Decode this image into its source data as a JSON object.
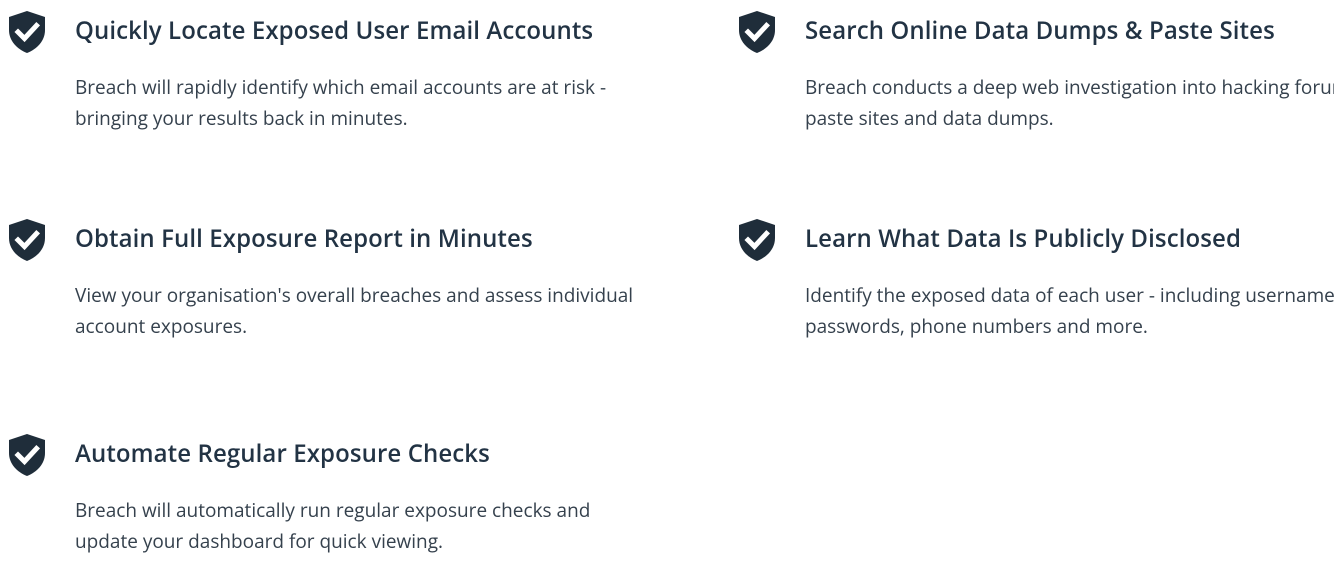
{
  "colors": {
    "icon": "#1f2d3a",
    "title": "#223344",
    "text": "#35414d",
    "background": "#ffffff"
  },
  "features": [
    {
      "icon": "shield-check-icon",
      "title": "Quickly Locate Exposed User Email Accounts",
      "description": "Breach will rapidly identify which email accounts are at risk - bringing your results back in minutes."
    },
    {
      "icon": "shield-check-icon",
      "title": "Search Online Data Dumps & Paste Sites",
      "description": "Breach conducts a deep web investigation into hacking forums, paste sites and data dumps."
    },
    {
      "icon": "shield-check-icon",
      "title": "Obtain Full Exposure Report in Minutes",
      "description": "View your organisation's overall breaches and assess individual account exposures."
    },
    {
      "icon": "shield-check-icon",
      "title": "Learn What Data Is Publicly Disclosed",
      "description": "Identify the exposed data of each user - including usernames, passwords, phone numbers and more."
    },
    {
      "icon": "shield-check-icon",
      "title": "Automate Regular Exposure Checks",
      "description": "Breach will automatically run regular exposure checks and update your dashboard for quick viewing."
    }
  ]
}
